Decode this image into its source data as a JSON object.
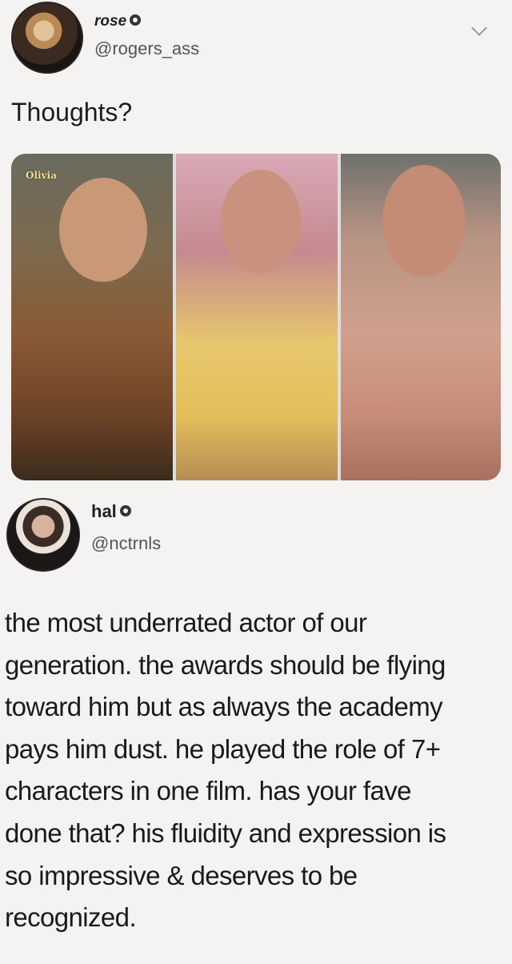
{
  "tweet1": {
    "name": "rose",
    "handle": "@rogers_ass",
    "text": "Thoughts?",
    "watermark": "Olivia"
  },
  "tweet2": {
    "name": "hal",
    "handle": "@nctrnls",
    "text_lines": [
      "the most underrated actor of our",
      "generation. the awards should be flying",
      "toward him but as always the academy",
      "pays him dust. he played the role of 7+",
      "characters in one film. has your fave",
      "done that? his fluidity and expression is",
      "so impressive & deserves to be",
      "recognized."
    ]
  },
  "icons": {
    "verified": "verified-icon",
    "chevron": "chevron-down-icon"
  }
}
